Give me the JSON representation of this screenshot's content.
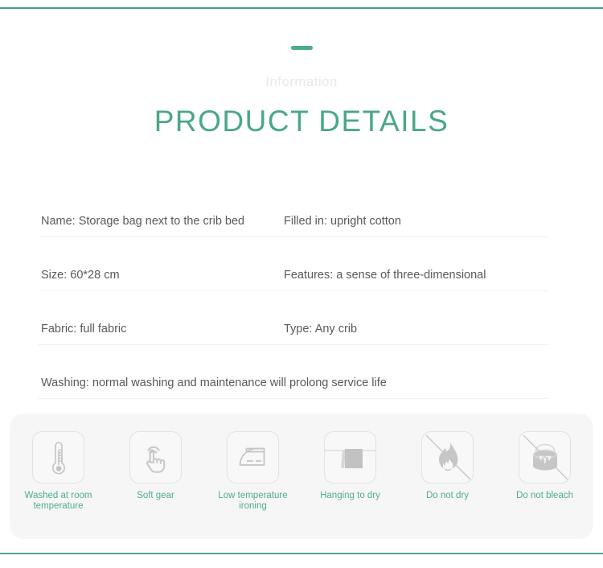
{
  "header": {
    "dash": "divider-dash",
    "subtitle": "Information",
    "title": "PRODUCT DETAILS"
  },
  "colors": {
    "accent_teal": "#3f9e94",
    "title_green": "#4aa886",
    "label_green": "#4fad8c",
    "subtitle_gray": "#e9e9e9",
    "body_gray": "#595959",
    "card_bg": "#f6f6f6",
    "icon_gray": "#bfbfbf",
    "divider": "#f0f0f0"
  },
  "spec_rows": [
    {
      "left": "Name: Storage bag next to the crib bed",
      "right": "Filled in: upright cotton"
    },
    {
      "left": "Size: 60*28 cm",
      "right": "Features: a sense of three-dimensional"
    },
    {
      "left": "Fabric: full fabric",
      "right": "Type: Any crib"
    },
    {
      "left": "Washing: normal washing and maintenance will prolong service life",
      "right": ""
    }
  ],
  "care_items": [
    {
      "icon": "thermometer-icon",
      "label": "Washed at room temperature"
    },
    {
      "icon": "hand-tap-icon",
      "label": "Soft gear"
    },
    {
      "icon": "iron-icon",
      "label": "Low temperature ironing"
    },
    {
      "icon": "hanging-cloth-icon",
      "label": "Hanging to dry"
    },
    {
      "icon": "no-flame-icon",
      "label": "Do not dry"
    },
    {
      "icon": "no-bleach-icon",
      "label": "Do not bleach"
    }
  ]
}
